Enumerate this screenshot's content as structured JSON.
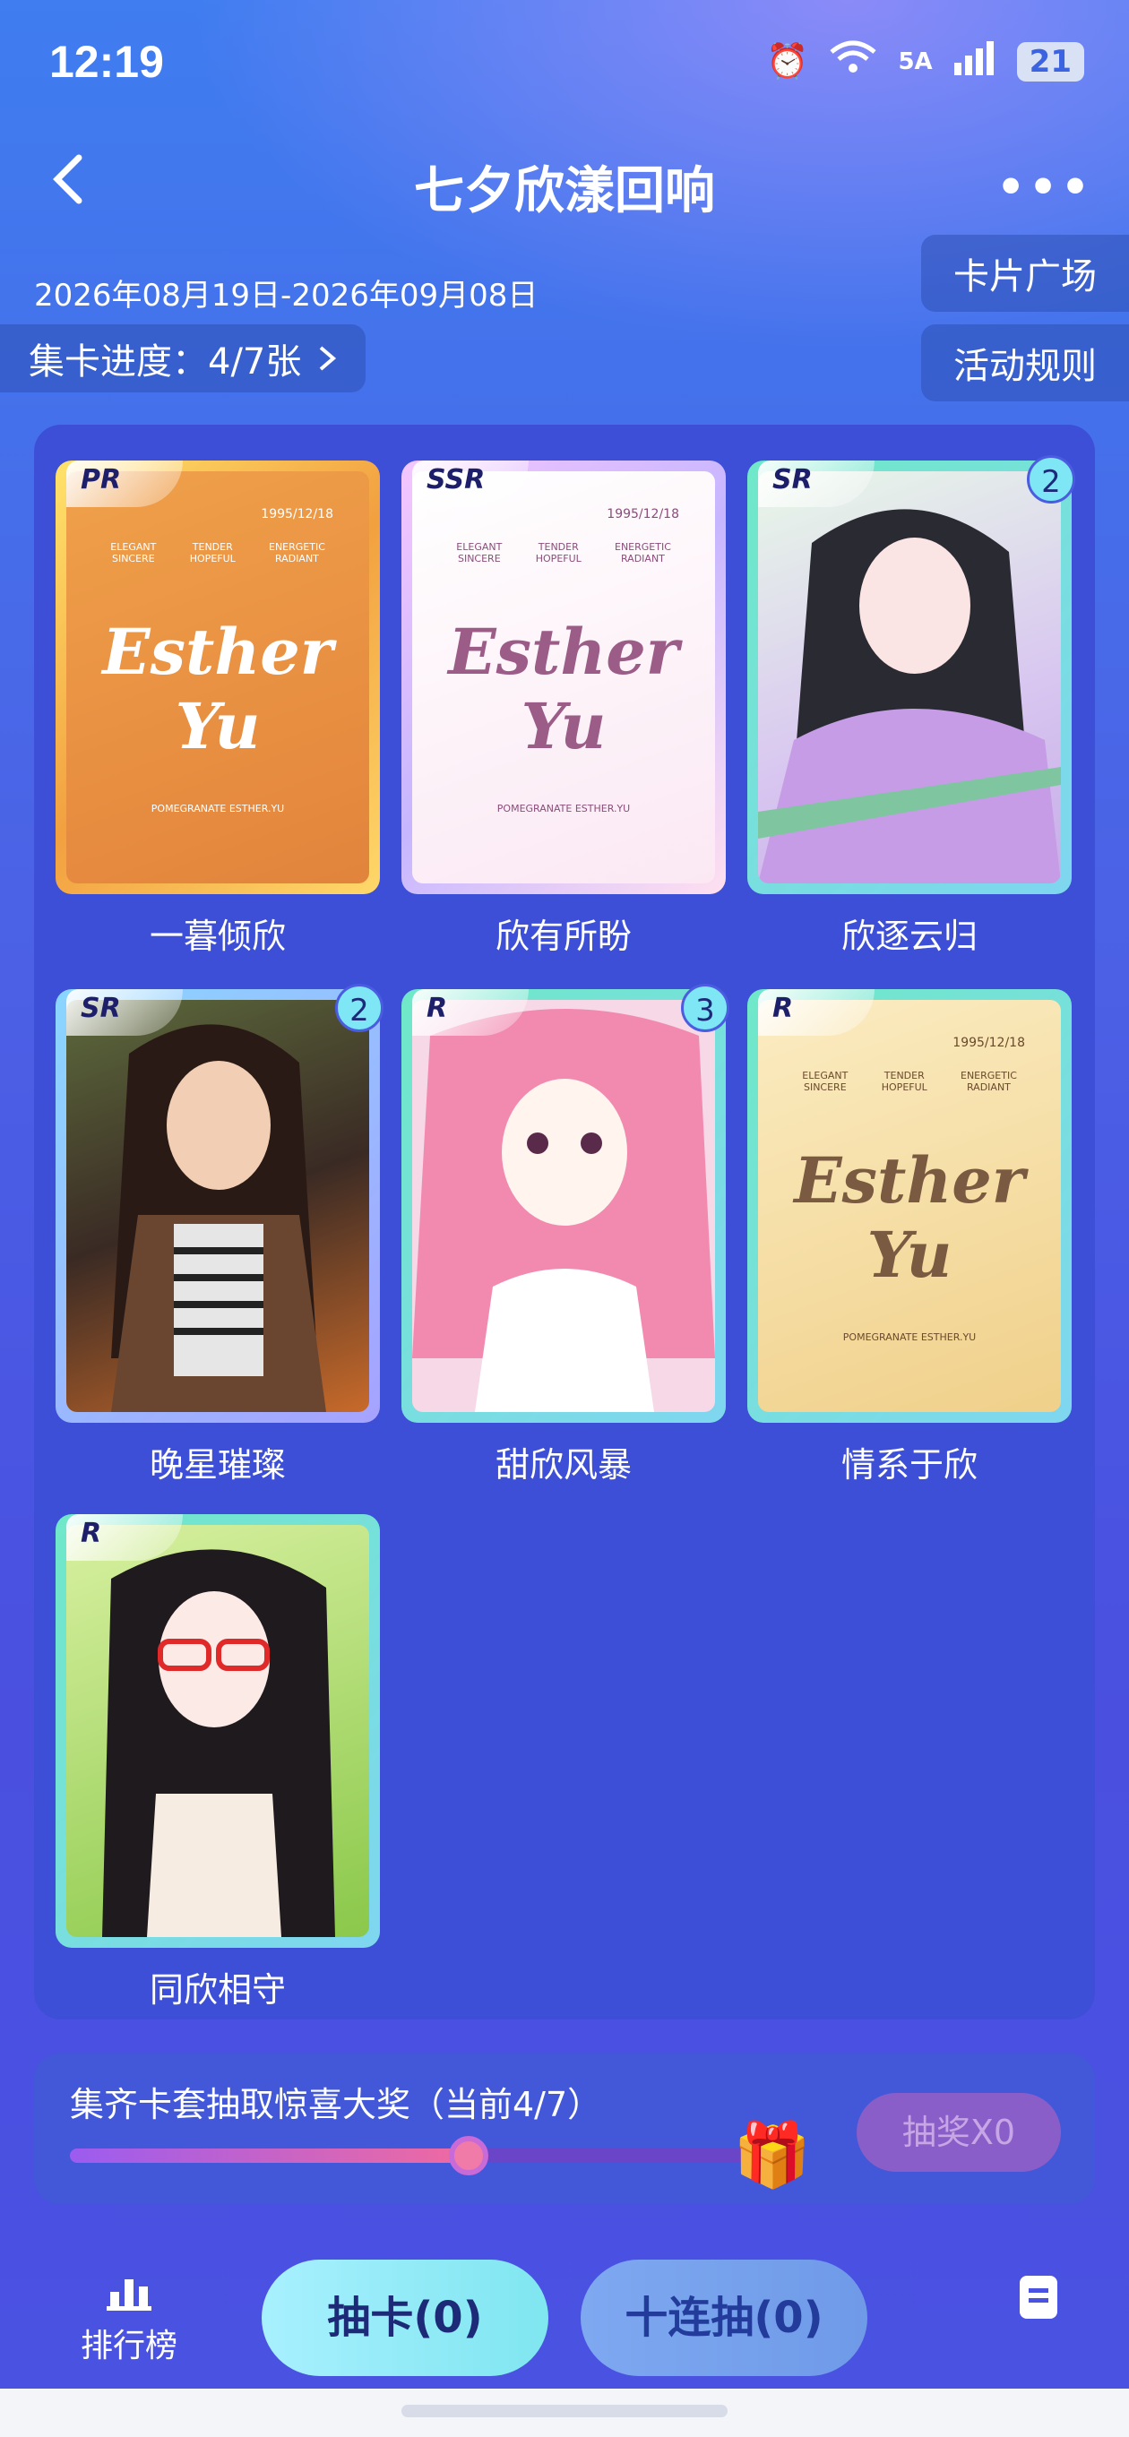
{
  "status_bar": {
    "time": "12:19",
    "network": "5A",
    "battery": "21"
  },
  "header": {
    "title": "七夕欣漾回响"
  },
  "event": {
    "date_range": "2026年08月19日-2026年09月08日",
    "progress_label": "集卡进度：4/7张",
    "card_square_label": "卡片广场",
    "rules_label": "活动规则"
  },
  "cards": [
    {
      "name": "一暮倾欣",
      "rarity": "PR",
      "count": ""
    },
    {
      "name": "欣有所盼",
      "rarity": "SSR",
      "count": ""
    },
    {
      "name": "欣逐云归",
      "rarity": "SR",
      "count": "2"
    },
    {
      "name": "晚星璀璨",
      "rarity": "SR",
      "count": "2"
    },
    {
      "name": "甜欣风暴",
      "rarity": "R",
      "count": "3"
    },
    {
      "name": "情系于欣",
      "rarity": "R",
      "count": ""
    },
    {
      "name": "同欣相守",
      "rarity": "R",
      "count": ""
    }
  ],
  "card_art": {
    "script_name": "Esther Yu",
    "date": "1995/12/18",
    "words": [
      "ELEGANT SINCERE",
      "TENDER HOPEFUL",
      "ENERGETIC RADIANT"
    ],
    "footer": "POMEGRANATE ESTHER.YU"
  },
  "prize": {
    "title": "集齐卡套抽取惊喜大奖（当前4/7）",
    "progress": 0.571,
    "draw_label": "抽奖X0"
  },
  "bottom_nav": {
    "rank_label": "排行榜",
    "draw_one_label": "抽卡(0)",
    "draw_ten_label": "十连抽(0)"
  }
}
